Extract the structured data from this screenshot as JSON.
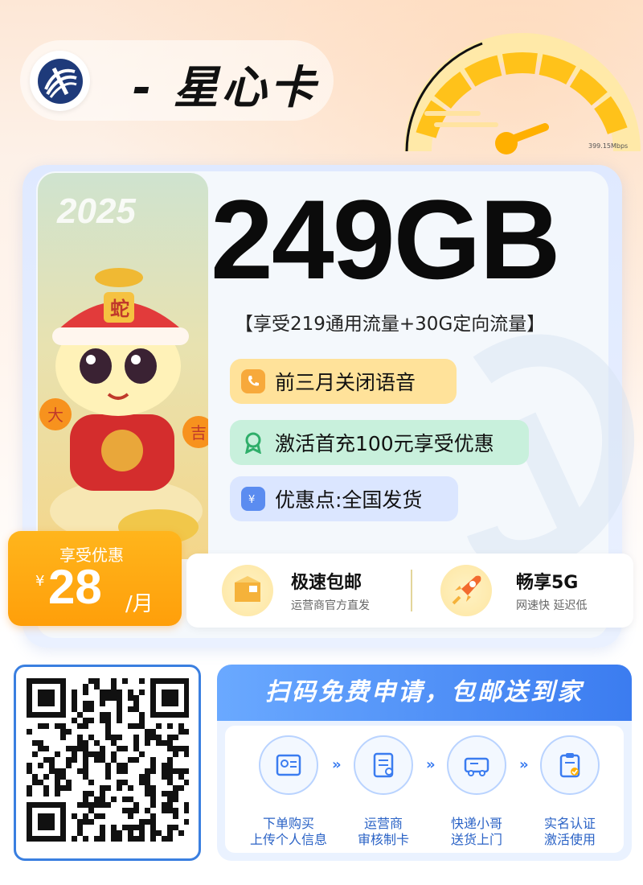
{
  "header": {
    "brand_title": "- 星心卡",
    "speed_label": "399.15Mbps"
  },
  "plan": {
    "data_total": "249GB",
    "data_detail": "【享受219通用流量+30G定向流量】",
    "features": [
      {
        "label": "前三月关闭语音",
        "icon": "phone-icon"
      },
      {
        "label": "激活首充100元享受优惠",
        "icon": "badge-icon"
      },
      {
        "label": "优惠点:全国发货",
        "icon": "coupon-icon"
      }
    ],
    "mascot_year": "2025",
    "mascot_hat": "蛇",
    "mascot_left": "大",
    "mascot_right": "吉"
  },
  "price": {
    "label": "享受优惠",
    "currency": "¥",
    "amount": "28",
    "unit": "/月"
  },
  "services": [
    {
      "title": "极速包邮",
      "desc": "运营商官方直发",
      "icon": "box-icon"
    },
    {
      "title": "畅享5G",
      "desc": "网速快 延迟低",
      "icon": "rocket-icon"
    }
  ],
  "apply": {
    "heading": "扫码免费申请，包邮送到家",
    "steps": [
      {
        "line1": "下单购买",
        "line2": "上传个人信息",
        "icon": "id-card-icon"
      },
      {
        "line1": "运营商",
        "line2": "审核制卡",
        "icon": "document-icon"
      },
      {
        "line1": "快递小哥",
        "line2": "送货上门",
        "icon": "truck-icon"
      },
      {
        "line1": "实名认证",
        "line2": "激活使用",
        "icon": "clipboard-check-icon"
      }
    ],
    "arrow": "»"
  },
  "colors": {
    "accent_orange": "#ff9f0a",
    "accent_blue": "#3b7cf0",
    "gauge_yellow": "#ffc21a"
  }
}
